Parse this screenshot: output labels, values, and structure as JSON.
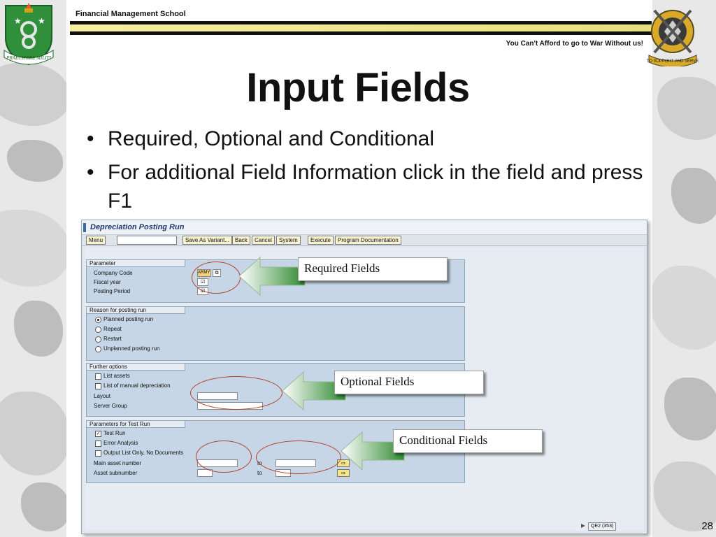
{
  "header": {
    "school": "Financial Management School",
    "motto": "You Can't Afford to go to War Without us!",
    "crest_left_motto": "PRAECIPERE MILITI",
    "crest_right_motto": "TO SUPPORT AND SERVE"
  },
  "slide": {
    "title": "Input Fields",
    "bullets": [
      "Required, Optional and Conditional",
      "For additional Field Information click in the field and press F1"
    ],
    "page_number": "28"
  },
  "sap": {
    "window_title": "Depreciation Posting Run",
    "toolbar": {
      "menu": "Menu",
      "command_value": "",
      "save_as_variant": "Save As Variant...",
      "back": "Back",
      "cancel": "Cancel",
      "system": "System",
      "execute": "Execute",
      "program_documentation": "Program Documentation"
    },
    "parameter": {
      "title": "Parameter",
      "company_code_label": "Company Code",
      "company_code_value": "ARMY",
      "fiscal_year_label": "Fiscal year",
      "posting_period_label": "Posting Period"
    },
    "reason": {
      "title": "Reason for posting run",
      "options": [
        "Planned posting run",
        "Repeat",
        "Restart",
        "Unplanned posting run"
      ],
      "selected": "Planned posting run"
    },
    "further": {
      "title": "Further options",
      "list_assets": "List assets",
      "list_manual": "List of manual depreciation",
      "layout_label": "Layout",
      "server_group_label": "Server Group"
    },
    "test_run": {
      "title": "Parameters for Test Run",
      "test_run": "Test Run",
      "error_analysis": "Error Analysis",
      "output_list": "Output List Only, No Documents",
      "main_asset_label": "Main asset number",
      "asset_sub_label": "Asset subnumber",
      "to_label": "to"
    },
    "status": "QE2 (353)"
  },
  "callouts": {
    "required": "Required Fields",
    "optional": "Optional Fields",
    "conditional": "Conditional Fields"
  },
  "colors": {
    "arrow_green": "#3f9a3a",
    "oval_red": "#b0402a",
    "sap_group": "#c7d6e6",
    "button_yellow": "#f7f2d0"
  }
}
